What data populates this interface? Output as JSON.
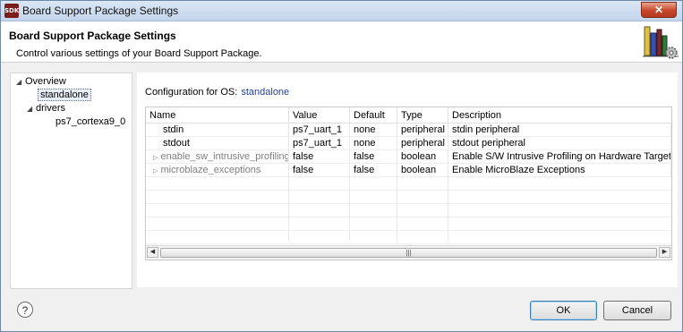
{
  "window": {
    "icon_text": "SDK",
    "title": "Board Support Package Settings",
    "close_glyph": "✕"
  },
  "header": {
    "title": "Board Support Package Settings",
    "subtitle": "Control various settings of your Board Support Package."
  },
  "tree": {
    "overview": "Overview",
    "standalone": "standalone",
    "drivers": "drivers",
    "driver_item": "ps7_cortexa9_0"
  },
  "config": {
    "label": "Configuration for OS:",
    "os_link": "standalone"
  },
  "table": {
    "headers": [
      "Name",
      "Value",
      "Default",
      "Type",
      "Description"
    ],
    "rows": [
      [
        "stdin",
        "ps7_uart_1",
        "none",
        "peripheral",
        "stdin peripheral"
      ],
      [
        "stdout",
        "ps7_uart_1",
        "none",
        "peripheral",
        "stdout peripheral"
      ],
      [
        "enable_sw_intrusive_profiling",
        "false",
        "false",
        "boolean",
        "Enable S/W Intrusive Profiling on Hardware Targets"
      ],
      [
        "microblaze_exceptions",
        "false",
        "false",
        "boolean",
        "Enable MicroBlaze Exceptions"
      ]
    ]
  },
  "footer": {
    "help_glyph": "?",
    "ok": "OK",
    "cancel": "Cancel"
  },
  "icons": {
    "app": "sdk-app-icon",
    "banner": "books-gear-icon",
    "expand": "triangle-down-icon",
    "collapsed": "triangle-right-icon"
  },
  "colors": {
    "link": "#1f3f9c",
    "title_bar": "#c3d5ec",
    "close_button": "#c9462a"
  }
}
